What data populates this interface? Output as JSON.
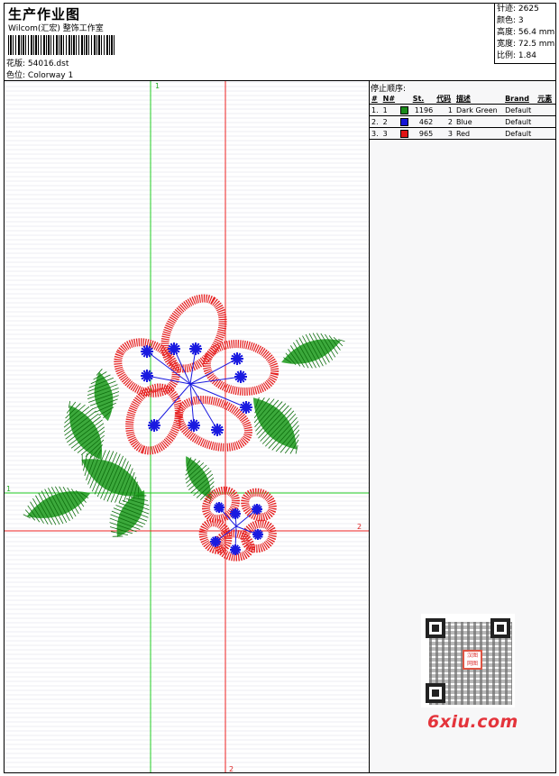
{
  "header": {
    "title": "生产作业图",
    "company": "Wilcom(汇宏) 整饰工作室",
    "design_label": "花版:",
    "design_value": "54016.dst",
    "colorway_label": "色位:",
    "colorway_value": "Colorway 1"
  },
  "stats": {
    "stitches": "针迹: 2625",
    "colors": "颜色: 3",
    "height": "高度: 56.4 mm",
    "width": "宽度: 72.5 mm",
    "ratio": "比例: 1.84"
  },
  "stop_sequence": {
    "title": "停止顺序:",
    "headers": [
      "#",
      "N#",
      "St.",
      "代码",
      "描述",
      "Brand",
      "元素"
    ],
    "rows": [
      {
        "idx": "1.",
        "n": "1",
        "color": "#1a8a1a",
        "stitches": "1196",
        "code": "1",
        "desc": "Dark Green",
        "brand": "Default"
      },
      {
        "idx": "2.",
        "n": "2",
        "color": "#1515d6",
        "stitches": "462",
        "code": "2",
        "desc": "Blue",
        "brand": "Default"
      },
      {
        "idx": "3.",
        "n": "3",
        "color": "#e01515",
        "stitches": "965",
        "code": "3",
        "desc": "Red",
        "brand": "Default"
      }
    ]
  },
  "guides": {
    "v1": "1",
    "h1": "1",
    "h2": "2",
    "v2": "2"
  },
  "colors": {
    "green": "#1a9a1a",
    "blue": "#1a1ae0",
    "red": "#e62020",
    "guide_green": "#22cc22",
    "guide_red": "#ee2222"
  },
  "watermark": "6xiu.com",
  "qr_logo": "汉图 网图"
}
